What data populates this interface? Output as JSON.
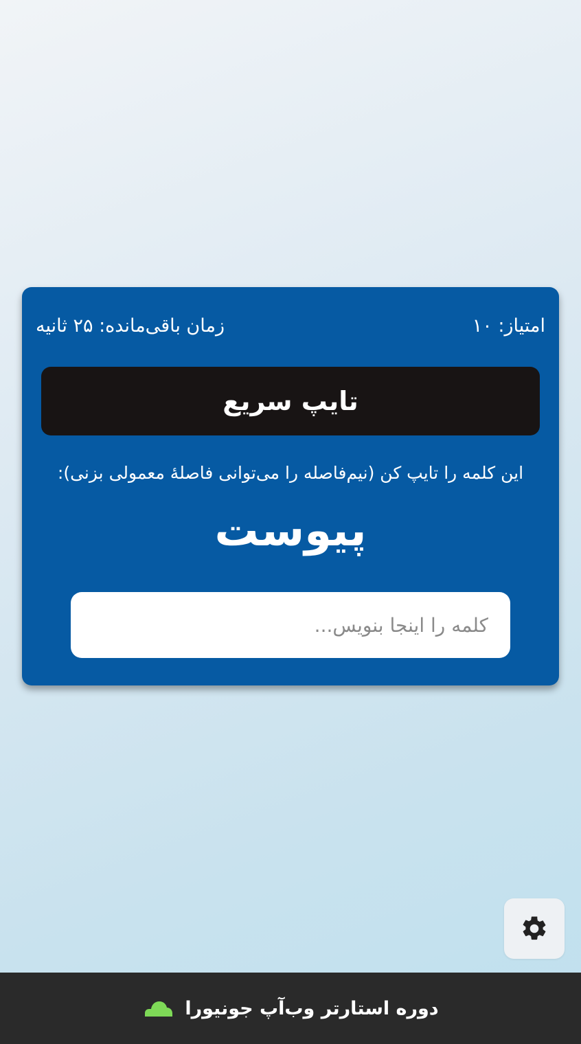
{
  "game": {
    "score_label": "امتیاز: ۱۰",
    "time_label": "زمان باقی‌مانده: ۲۵ ثانیه",
    "title": "تایپ سریع",
    "instruction": "این کلمه را تایپ کن (نیم‌فاصله را می‌توانی فاصلهٔ معمولی بزنی):",
    "target_word": "پیوست",
    "input": {
      "value": "",
      "placeholder": "کلمه را اینجا بنویس..."
    }
  },
  "settings": {
    "icon": "gear-icon"
  },
  "footer": {
    "text": "دوره استارتر وب‌آپ جونیورا",
    "icon": "cloud-icon",
    "icon_color": "#7ed957"
  },
  "colors": {
    "card": "#065aa3",
    "title_bar": "#181414",
    "footer": "#2a2a2a"
  }
}
